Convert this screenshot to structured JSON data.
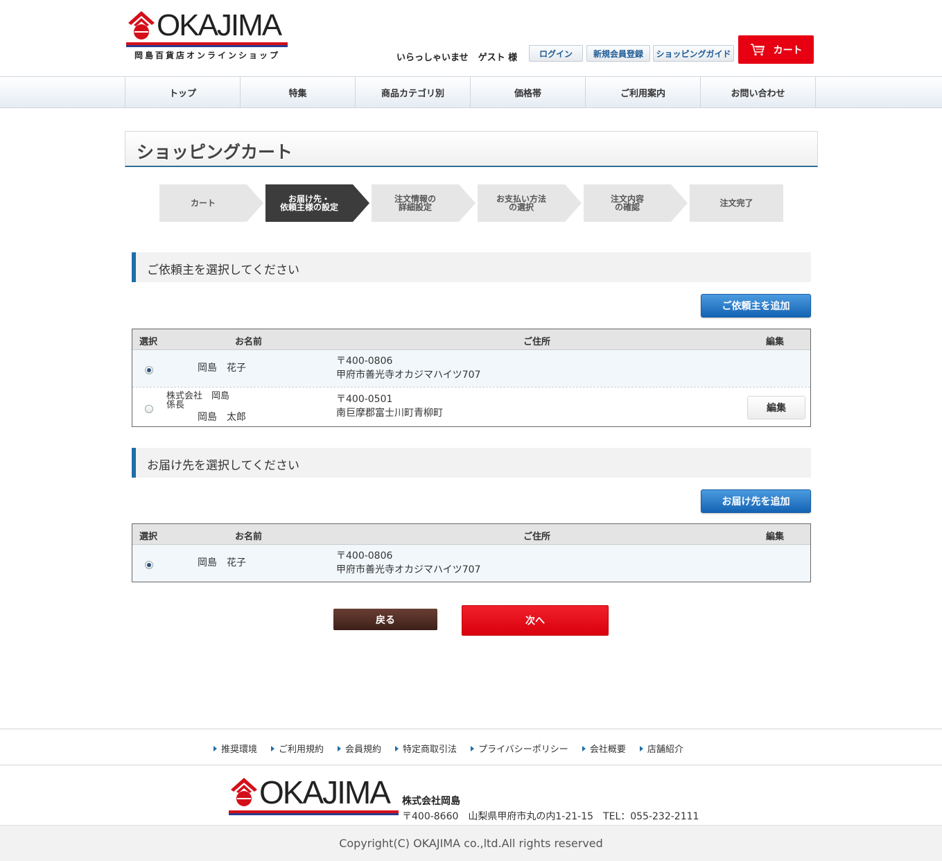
{
  "brand": {
    "logo_text": "OKAJIMA",
    "subtitle": "岡島百貨店オンラインショップ",
    "colors": {
      "red": "#d40f1a",
      "blue": "#2a3d8f"
    }
  },
  "header": {
    "welcome": "いらっしゃいませ",
    "guest": "ゲスト 様",
    "login": "ログイン",
    "register": "新規会員登録",
    "guide": "ショッピングガイド",
    "cart": "カート"
  },
  "nav": {
    "items": [
      {
        "label": "トップ"
      },
      {
        "label": "特集"
      },
      {
        "label": "商品カテゴリ別"
      },
      {
        "label": "価格帯"
      },
      {
        "label": "ご利用案内"
      },
      {
        "label": "お問い合わせ"
      }
    ]
  },
  "page": {
    "title": "ショッピングカート"
  },
  "steps": [
    {
      "label": "カート",
      "active": false
    },
    {
      "label": "お届け先・\n依頼主様の設定",
      "active": true
    },
    {
      "label": "注文情報の\n詳細設定",
      "active": false
    },
    {
      "label": "お支払い方法\nの選択",
      "active": false
    },
    {
      "label": "注文内容\nの確認",
      "active": false
    },
    {
      "label": "注文完了",
      "active": false
    }
  ],
  "requester": {
    "heading": "ご依頼主を選択してください",
    "add_button": "ご依頼主を追加",
    "columns": {
      "select": "選択",
      "name": "お名前",
      "address": "ご住所",
      "edit": "編集"
    },
    "rows": [
      {
        "selected": true,
        "name": "岡島　花子",
        "zip": "〒400-0806",
        "address": "甲府市善光寺オカジマハイツ707"
      },
      {
        "selected": false,
        "company": "株式会社　岡島",
        "title": "係長",
        "name": "岡島　太郎",
        "zip": "〒400-0501",
        "address": "南巨摩郡富士川町青柳町",
        "edit_label": "編集"
      }
    ]
  },
  "delivery": {
    "heading": "お届け先を選択してください",
    "add_button": "お届け先を追加",
    "columns": {
      "select": "選択",
      "name": "お名前",
      "address": "ご住所",
      "edit": "編集"
    },
    "rows": [
      {
        "selected": true,
        "name": "岡島　花子",
        "zip": "〒400-0806",
        "address": "甲府市善光寺オカジマハイツ707"
      }
    ]
  },
  "actions": {
    "back": "戻る",
    "next": "次へ"
  },
  "footer": {
    "links": [
      "推奨環境",
      "ご利用規約",
      "会員規約",
      "特定商取引法",
      "プライバシーポリシー",
      "会社概要",
      "店舗紹介"
    ],
    "company": "株式会社岡島",
    "address": "〒400-8660　山梨県甲府市丸の内1-21-15　TEL：055-232-2111",
    "copyright": "Copyright(C) OKAJIMA co.,ltd.All rights reserved"
  }
}
